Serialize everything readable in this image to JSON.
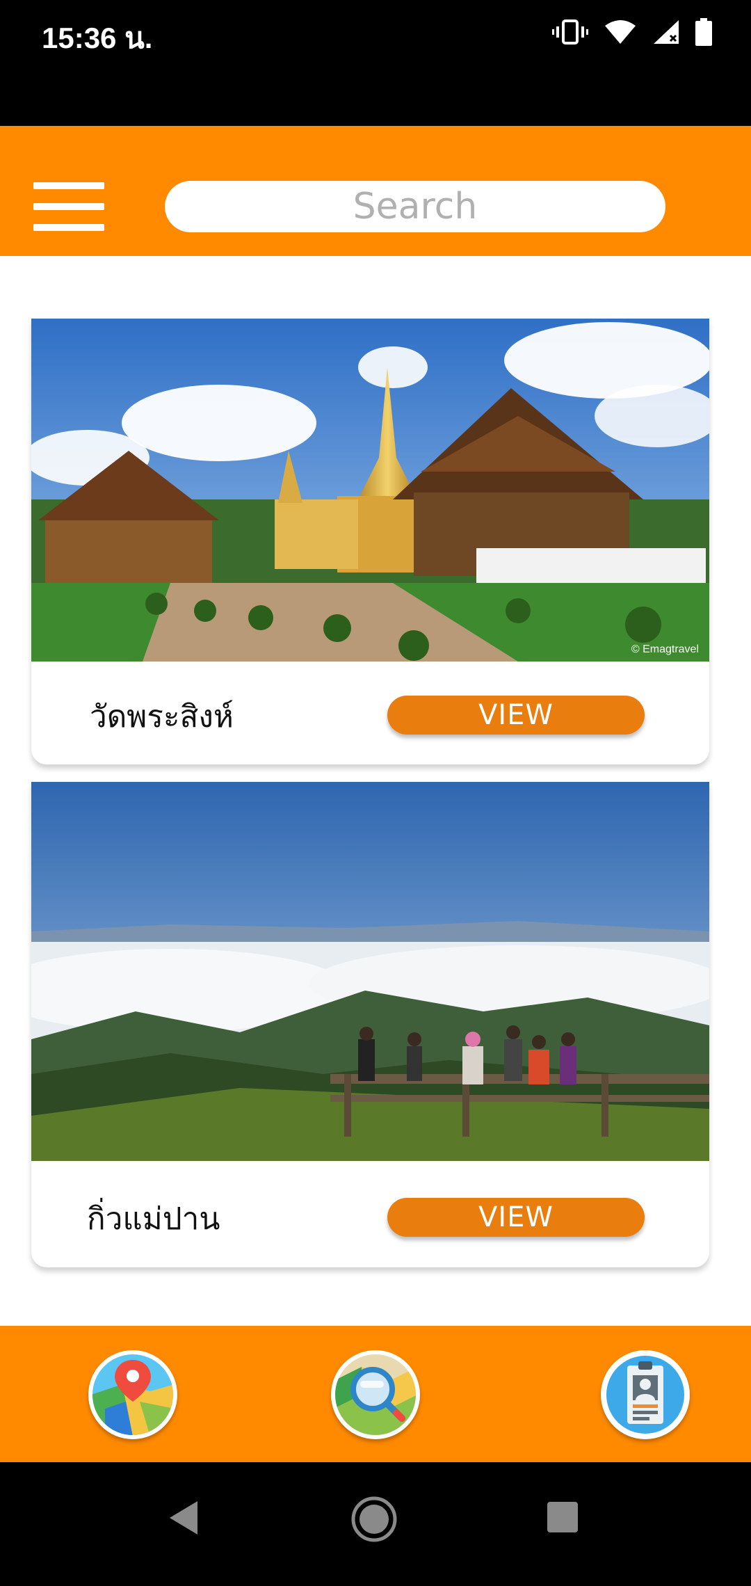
{
  "status_bar": {
    "time": "15:36 น."
  },
  "header": {
    "search": {
      "placeholder": "Search",
      "value": ""
    },
    "icons": {
      "menu": "hamburger-menu-icon"
    }
  },
  "cards": [
    {
      "title": "วัดพระสิงห์",
      "button_label": "VIEW",
      "image_subject": "temple-photo",
      "image_credit": "© Emagtravel"
    },
    {
      "title": "กิ่วแม่ปาน",
      "button_label": "VIEW",
      "image_subject": "mountain-viewpoint-photo"
    }
  ],
  "bottom_nav": [
    {
      "icon": "map-pin-icon"
    },
    {
      "icon": "map-search-icon"
    },
    {
      "icon": "id-badge-icon"
    }
  ],
  "colors": {
    "primary": "#FF8A00",
    "button": "#E97E0E",
    "status_bar": "#000000"
  }
}
